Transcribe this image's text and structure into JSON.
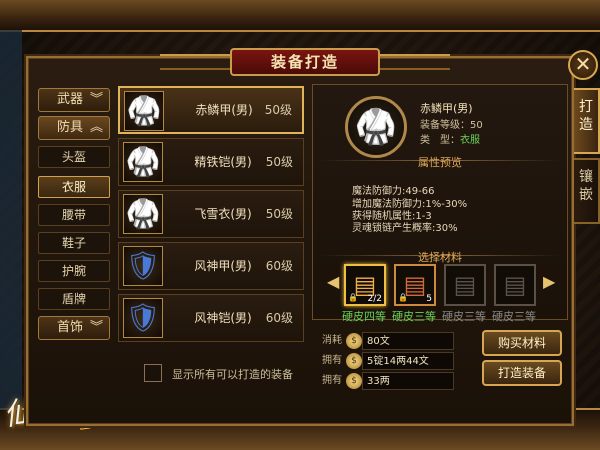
{
  "title": "装备打造",
  "close_label": "✕",
  "tabs": [
    {
      "label": "打\n造",
      "active": true
    },
    {
      "label": "镶\n嵌",
      "active": false
    }
  ],
  "categories": {
    "weapon": "武器",
    "armor": "防具",
    "jewelry": "首饰",
    "armor_subs": [
      "头盔",
      "衣服",
      "腰带",
      "鞋子",
      "护腕",
      "盾牌"
    ],
    "selected_sub": "衣服"
  },
  "items": [
    {
      "name": "赤鳞甲(男)",
      "level": "50级",
      "icon": "red-armor-icon"
    },
    {
      "name": "精铁铠(男)",
      "level": "50级",
      "icon": "red-armor-icon"
    },
    {
      "name": "飞雪衣(男)",
      "level": "50级",
      "icon": "red-armor-icon"
    },
    {
      "name": "风神甲(男)",
      "level": "60级",
      "icon": "blue-armor-icon"
    },
    {
      "name": "风神铠(男)",
      "level": "60级",
      "icon": "blue-armor-icon"
    }
  ],
  "show_all_label": "显示所有可以打造的装备",
  "detail": {
    "name": "赤鳞甲(男)",
    "level_line": "装备等级：50",
    "type_label": "类　型：",
    "type_value": "衣服",
    "attr_title": "属性预览",
    "attrs": [
      "魔法防御力:49-66",
      "增加魔法防御力:1%-30%",
      "获得随机属性:1-3",
      "灵魂锁链产生概率:30%"
    ],
    "materials_title": "选择材料",
    "materials": [
      {
        "label": "硬皮",
        "grade": "四等",
        "count": "2/2",
        "style": "gold"
      },
      {
        "label": "硬皮",
        "grade": "三等",
        "count": "5",
        "style": "copper"
      },
      {
        "label": "硬皮",
        "grade": "三等",
        "count": "",
        "style": "grey"
      },
      {
        "label": "硬皮",
        "grade": "三等",
        "count": "",
        "style": "grey"
      }
    ]
  },
  "costs": [
    {
      "label": "消耗",
      "value": "80文"
    },
    {
      "label": "拥有",
      "value": "5锭14两44文"
    },
    {
      "label": "拥有",
      "value": "33两"
    }
  ],
  "buttons": {
    "buy": "购买材料",
    "craft": "打造装备"
  },
  "logo_text": "仙途",
  "colors": {
    "accent_gold": "#d6a650",
    "title_red": "#7a1410",
    "green_value": "#6ad35a"
  }
}
